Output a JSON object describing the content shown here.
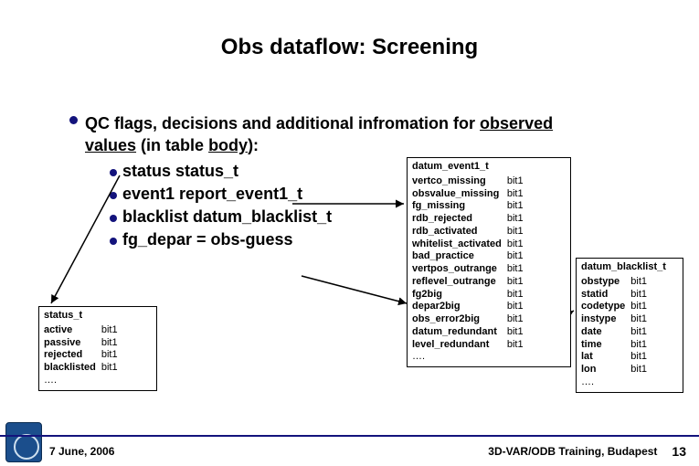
{
  "title": "Obs dataflow: Screening",
  "main": {
    "line_html": "QC flags, decisions and additional infromation for <span class=\"u\">observed values</span> (in table <span class=\"u\">body</span>):",
    "bullets": [
      {
        "label": "status",
        "value": "status_t"
      },
      {
        "label": "event1",
        "value": "report_event1_t"
      },
      {
        "label": "blacklist",
        "value": "datum_blacklist_t"
      },
      {
        "label": "fg_depar",
        "value": "= obs-guess"
      }
    ]
  },
  "status_box": {
    "header": "status_t",
    "rows": [
      [
        "active",
        "bit1"
      ],
      [
        "passive",
        "bit1"
      ],
      [
        "rejected",
        "bit1"
      ],
      [
        "blacklisted",
        "bit1"
      ]
    ],
    "ellipsis": "…."
  },
  "datum_box": {
    "header": "datum_event1_t",
    "rows": [
      [
        "vertco_missing",
        "bit1"
      ],
      [
        "obsvalue_missing",
        "bit1"
      ],
      [
        "fg_missing",
        "bit1"
      ],
      [
        "rdb_rejected",
        "bit1"
      ],
      [
        "rdb_activated",
        "bit1"
      ],
      [
        "whitelist_activated",
        "bit1"
      ],
      [
        "bad_practice",
        "bit1"
      ],
      [
        "vertpos_outrange",
        "bit1"
      ],
      [
        "reflevel_outrange",
        "bit1"
      ],
      [
        "fg2big",
        "bit1"
      ],
      [
        "depar2big",
        "bit1"
      ],
      [
        "obs_error2big",
        "bit1"
      ],
      [
        "datum_redundant",
        "bit1"
      ],
      [
        "level_redundant",
        "bit1"
      ]
    ],
    "ellipsis": "…."
  },
  "blacklist_box": {
    "header": "datum_blacklist_t",
    "rows": [
      [
        "obstype",
        "bit1"
      ],
      [
        "statid",
        "bit1"
      ],
      [
        "codetype",
        "bit1"
      ],
      [
        "instype",
        "bit1"
      ],
      [
        "date",
        "bit1"
      ],
      [
        "time",
        "bit1"
      ],
      [
        "lat",
        "bit1"
      ],
      [
        "lon",
        "bit1"
      ]
    ],
    "ellipsis": "…."
  },
  "footer": {
    "date": "7 June, 2006",
    "venue": "3D-VAR/ODB Training, Budapest",
    "page": "13"
  }
}
